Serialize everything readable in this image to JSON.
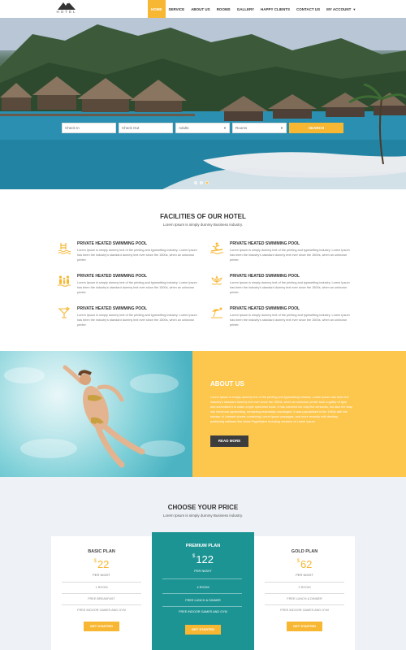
{
  "header": {
    "logo_text": "HOTEL",
    "nav": [
      {
        "label": "HOME",
        "active": true
      },
      {
        "label": "SERVICE"
      },
      {
        "label": "ABOUT US"
      },
      {
        "label": "ROOMS"
      },
      {
        "label": "GALLERY"
      },
      {
        "label": "HAPPY CLIENTS"
      },
      {
        "label": "CONTACT US"
      },
      {
        "label": "MY ACCOUNT"
      }
    ]
  },
  "search": {
    "check_in": "Check In",
    "check_out": "Check Out",
    "adults": "Adults",
    "rooms": "Rooms",
    "button": "SEARCH"
  },
  "slider": {
    "slides": 3,
    "active": 2
  },
  "facilities": {
    "title": "FACILITIES OF OUR HOTEL",
    "subtitle": "Lorem Ipsum is simply dummy Business industry.",
    "items": [
      {
        "icon": "pool-icon",
        "title": "PRIVATE HEATED SWIMMING POOL",
        "text": "Lorem Ipsum is simply dummy text of the printing and typesetting industry. Lorem Ipsum has been the industry's standard dummy text ever since the 1500s, when an unknown printer."
      },
      {
        "icon": "surf-icon",
        "title": "PRIVATE HEATED SWIMMING POOL",
        "text": "Lorem Ipsum is simply dummy text of the printing and typesetting industry. Lorem Ipsum has been the industry's standard dummy text ever since the 1500s, when an unknown printer."
      },
      {
        "icon": "family-icon",
        "title": "PRIVATE HEATED SWIMMING POOL",
        "text": "Lorem Ipsum is simply dummy text of the printing and typesetting industry. Lorem Ipsum has been the industry's standard dummy text ever since the 1500s, when an unknown printer."
      },
      {
        "icon": "spa-icon",
        "title": "PRIVATE HEATED SWIMMING POOL",
        "text": "Lorem Ipsum is simply dummy text of the printing and typesetting industry. Lorem Ipsum has been the industry's standard dummy text ever since the 1500s, when an unknown printer."
      },
      {
        "icon": "cocktail-icon",
        "title": "PRIVATE HEATED SWIMMING POOL",
        "text": "Lorem Ipsum is simply dummy text of the printing and typesetting industry. Lorem Ipsum has been the industry's standard dummy text ever since the 1500s, when an unknown printer."
      },
      {
        "icon": "beach-icon",
        "title": "PRIVATE HEATED SWIMMING POOL",
        "text": "Lorem Ipsum is simply dummy text of the printing and typesetting industry. Lorem Ipsum has been the industry's standard dummy text ever since the 1500s, when an unknown printer."
      }
    ]
  },
  "about": {
    "title": "ABOUT US",
    "text": "Lorem Ipsum is simply dummy text of the printing and typesetting industry. Lorem Ipsum has been the industry's standard dummy text ever since the 1500s, when an unknown printer took a galley of type and scrambled it to make a type specimen book. It has survived not only five centuries, but also the leap into electronic typesetting, remaining essentially unchanged. It was popularised in the 1960s with the release of Letraset sheets containing Lorem Ipsum passages, and more recently with desktop publishing software like Aldus PageMaker including versions of Lorem Ipsum.",
    "button": "READ MORE"
  },
  "pricing": {
    "title": "CHOOSE YOUR PRICE",
    "subtitle": "Lorem Ipsum is simply dummy Business industry.",
    "plans": [
      {
        "name": "BASIC PLAN",
        "currency": "$",
        "price": "22",
        "period": "PER NIGHT",
        "features": [
          "1 ROOM",
          "FREE BREAKFAST",
          "FREE INDOOR GAMES AND GYM"
        ],
        "button": "GET STARTED"
      },
      {
        "name": "PREMIUM PLAN",
        "currency": "$",
        "price": "122",
        "period": "PER NIGHT",
        "features": [
          "4 ROOM",
          "FREE LUNCH & DINNER",
          "FREE INDOOR GAMES AND GYM"
        ],
        "button": "GET STARTED"
      },
      {
        "name": "GOLD PLAN",
        "currency": "$",
        "price": "62",
        "period": "PER NIGHT",
        "features": [
          "2 ROOM",
          "FREE LUNCH & DINNER",
          "FREE INDOOR GAMES AND GYM"
        ],
        "button": "GET STARTED"
      }
    ]
  },
  "colors": {
    "accent": "#f7b733",
    "about_bg": "#fdc64d",
    "premium": "#1d9494",
    "pricing_bg": "#eef1f6"
  }
}
